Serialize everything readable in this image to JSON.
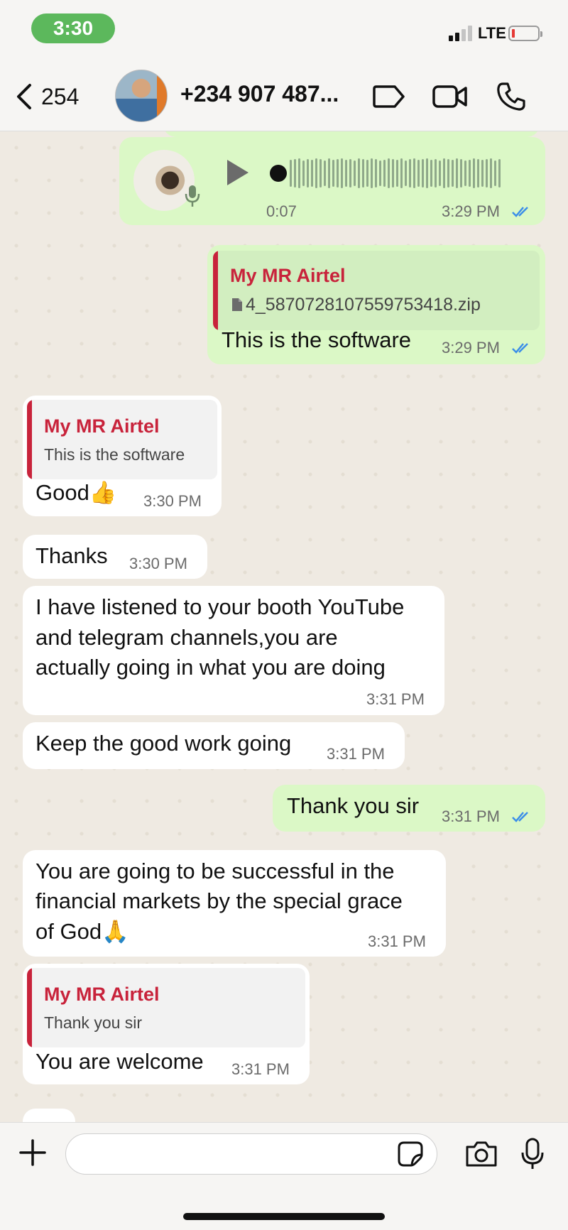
{
  "status_bar": {
    "time": "3:30",
    "network": "LTE",
    "battery_level": 0.08
  },
  "header": {
    "back_count": "254",
    "contact_name": "+234 907 487...",
    "icons": [
      "chevron-left-icon",
      "sticker-label-icon",
      "video-call-icon",
      "phone-icon"
    ]
  },
  "messages": [
    {
      "direction": "out",
      "type": "voice",
      "duration": "0:07",
      "time": "3:29 PM",
      "status": "read"
    },
    {
      "direction": "out",
      "type": "reply_file",
      "quote": {
        "author": "My MR Airtel",
        "file_name": "4_5870728107559753418.zip"
      },
      "text": "This is the software",
      "time": "3:29 PM",
      "status": "read"
    },
    {
      "direction": "in",
      "type": "reply",
      "quote": {
        "author": "My MR Airtel",
        "text": "This is the software"
      },
      "text": "Good👍",
      "time": "3:30 PM"
    },
    {
      "direction": "in",
      "type": "text",
      "text": "Thanks",
      "time": "3:30 PM"
    },
    {
      "direction": "in",
      "type": "text",
      "lines": [
        "I have listened to your booth YouTube",
        "and telegram channels,you are",
        "actually going in what you are doing"
      ],
      "time": "3:31 PM"
    },
    {
      "direction": "in",
      "type": "text",
      "text": "Keep the good work going",
      "time": "3:31 PM"
    },
    {
      "direction": "out",
      "type": "text",
      "text": "Thank you sir",
      "time": "3:31 PM",
      "status": "read"
    },
    {
      "direction": "in",
      "type": "text",
      "lines": [
        "You are going to be successful in the",
        "financial markets by the special grace",
        "of God🙏"
      ],
      "time": "3:31 PM"
    },
    {
      "direction": "in",
      "type": "reply",
      "quote": {
        "author": "My MR Airtel",
        "text": "Thank you sir"
      },
      "text": "You are welcome",
      "time": "3:31 PM"
    }
  ],
  "input_bar": {
    "message_value": "",
    "icons": [
      "plus-icon",
      "sticker-icon",
      "camera-icon",
      "microphone-icon"
    ]
  },
  "colors": {
    "outgoing_bubble": "#dbf8c6",
    "incoming_bubble": "#ffffff",
    "quote_accent": "#c8233b",
    "read_ticks": "#3b8ee8",
    "status_pill": "#5cb85c"
  }
}
